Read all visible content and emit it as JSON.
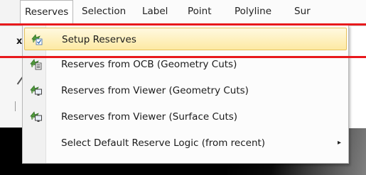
{
  "menubar": {
    "items": [
      {
        "label": "Reserves"
      },
      {
        "label": "Selection"
      },
      {
        "label": "Label"
      },
      {
        "label": "Point"
      },
      {
        "label": "Polyline"
      },
      {
        "label": "Sur"
      }
    ]
  },
  "background": {
    "x_glyph": "x"
  },
  "dropdown": {
    "items": [
      {
        "label": "Setup Reserves",
        "icon": "setup-reserves-icon",
        "highlighted": true
      },
      {
        "label": "Reserves from OCB (Geometry Cuts)",
        "icon": "reserves-ocb-icon"
      },
      {
        "label": "Reserves from Viewer (Geometry Cuts)",
        "icon": "reserves-viewer-geometry-icon"
      },
      {
        "label": "Reserves from Viewer (Surface Cuts)",
        "icon": "reserves-viewer-surface-icon"
      },
      {
        "label": "Select Default Reserve Logic (from recent)",
        "submenu_arrow": "▸"
      }
    ]
  },
  "colors": {
    "highlight": "#fde9a3",
    "highlight_border": "#e6c25c",
    "annotation_red": "#e8191c",
    "icon_green": "#3c8a2e"
  }
}
